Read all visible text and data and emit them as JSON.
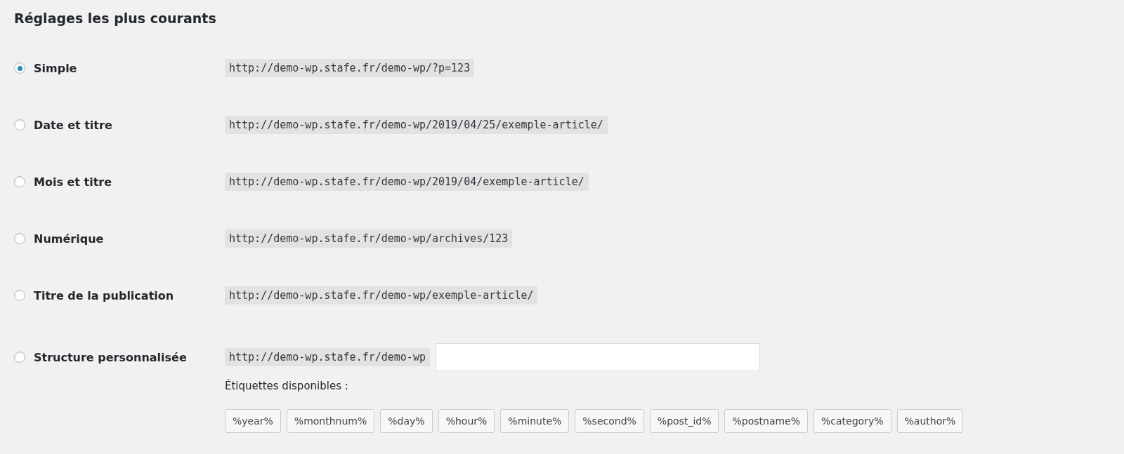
{
  "heading": "Réglages les plus courants",
  "options": [
    {
      "label": "Simple",
      "url": "http://demo-wp.stafe.fr/demo-wp/?p=123",
      "selected": true
    },
    {
      "label": "Date et titre",
      "url": "http://demo-wp.stafe.fr/demo-wp/2019/04/25/exemple-article/",
      "selected": false
    },
    {
      "label": "Mois et titre",
      "url": "http://demo-wp.stafe.fr/demo-wp/2019/04/exemple-article/",
      "selected": false
    },
    {
      "label": "Numérique",
      "url": "http://demo-wp.stafe.fr/demo-wp/archives/123",
      "selected": false
    },
    {
      "label": "Titre de la publication",
      "url": "http://demo-wp.stafe.fr/demo-wp/exemple-article/",
      "selected": false
    }
  ],
  "custom": {
    "label": "Structure personnalisée",
    "url": "http://demo-wp.stafe.fr/demo-wp",
    "selected": false,
    "tags_label": "Étiquettes disponibles :",
    "tags": [
      "%year%",
      "%monthnum%",
      "%day%",
      "%hour%",
      "%minute%",
      "%second%",
      "%post_id%",
      "%postname%",
      "%category%",
      "%author%"
    ]
  }
}
